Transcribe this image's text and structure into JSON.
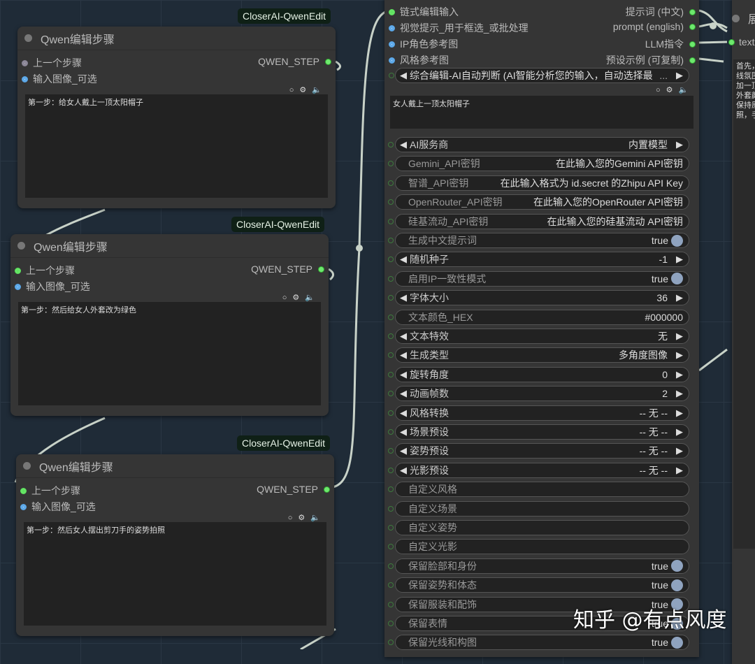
{
  "steps": [
    {
      "badge": "CloserAI-QwenEdit",
      "title": "Qwen编辑步骤",
      "in1": "上一个步骤",
      "in2": "输入图像_可选",
      "out": "QWEN_STEP",
      "text": "第一步：给女人戴上一顶太阳帽子"
    },
    {
      "badge": "CloserAI-QwenEdit",
      "title": "Qwen编辑步骤",
      "in1": "上一个步骤",
      "in2": "输入图像_可选",
      "out": "QWEN_STEP",
      "text": "第一步：然后给女人外套改为绿色"
    },
    {
      "badge": "CloserAI-QwenEdit",
      "title": "Qwen编辑步骤",
      "in1": "上一个步骤",
      "in2": "输入图像_可选",
      "out": "QWEN_STEP",
      "text": "第一步：然后女人摆出剪刀手的姿势拍照"
    }
  ],
  "main": {
    "inputs": [
      "链式编辑输入",
      "视觉提示_用于框选_或批处理",
      "IP角色参考图",
      "风格参考图"
    ],
    "outputs": [
      "提示词 (中文)",
      "prompt (english)",
      "LLM指令",
      "预设示例 (可复制)"
    ],
    "mode": "综合编辑-AI自动判断 (AI智能分析您的输入，自动选择最",
    "mode_ellipsis": "...",
    "text": "女人戴上一顶太阳帽子",
    "widgets": [
      {
        "type": "combo",
        "label": "AI服务商",
        "value": "内置模型"
      },
      {
        "type": "text",
        "label": "Gemini_API密钥",
        "value": "在此输入您的Gemini API密钥"
      },
      {
        "type": "text",
        "label": "智谱_API密钥",
        "value": "在此输入格式为 id.secret 的Zhipu API Key"
      },
      {
        "type": "text",
        "label": "OpenRouter_API密钥",
        "value": "在此输入您的OpenRouter API密钥"
      },
      {
        "type": "text",
        "label": "硅基流动_API密钥",
        "value": "在此输入您的硅基流动 API密钥"
      },
      {
        "type": "toggle",
        "label": "生成中文提示词",
        "value": "true"
      },
      {
        "type": "combo",
        "label": "随机种子",
        "value": "-1"
      },
      {
        "type": "toggle",
        "label": "启用IP一致性模式",
        "value": "true"
      },
      {
        "type": "combo",
        "label": "字体大小",
        "value": "36"
      },
      {
        "type": "text",
        "label": "文本颜色_HEX",
        "value": "#000000"
      },
      {
        "type": "combo",
        "label": "文本特效",
        "value": "无"
      },
      {
        "type": "combo",
        "label": "生成类型",
        "value": "多角度图像"
      },
      {
        "type": "combo",
        "label": "旋转角度",
        "value": "0"
      },
      {
        "type": "combo",
        "label": "动画帧数",
        "value": "2"
      },
      {
        "type": "combo",
        "label": "风格转换",
        "value": "-- 无 --"
      },
      {
        "type": "combo",
        "label": "场景预设",
        "value": "-- 无 --"
      },
      {
        "type": "combo",
        "label": "姿势预设",
        "value": "-- 无 --"
      },
      {
        "type": "combo",
        "label": "光影预设",
        "value": "-- 无 --"
      },
      {
        "type": "text",
        "label": "自定义风格",
        "value": ""
      },
      {
        "type": "text",
        "label": "自定义场景",
        "value": ""
      },
      {
        "type": "text",
        "label": "自定义姿势",
        "value": ""
      },
      {
        "type": "text",
        "label": "自定义光影",
        "value": ""
      },
      {
        "type": "toggle",
        "label": "保留脸部和身份",
        "value": "true"
      },
      {
        "type": "toggle",
        "label": "保留姿势和体态",
        "value": "true"
      },
      {
        "type": "toggle",
        "label": "保留服装和配饰",
        "value": "true"
      },
      {
        "type": "toggle",
        "label": "保留表情",
        "value": "true"
      },
      {
        "type": "toggle",
        "label": "保留光线和构图",
        "value": "true"
      }
    ]
  },
  "right": {
    "title": "展",
    "input": "text",
    "lines": [
      "首先，",
      "线氛围",
      "加一顶",
      "外套颜",
      "保持原",
      "照，手"
    ]
  },
  "watermark": "知乎 @有点风度"
}
